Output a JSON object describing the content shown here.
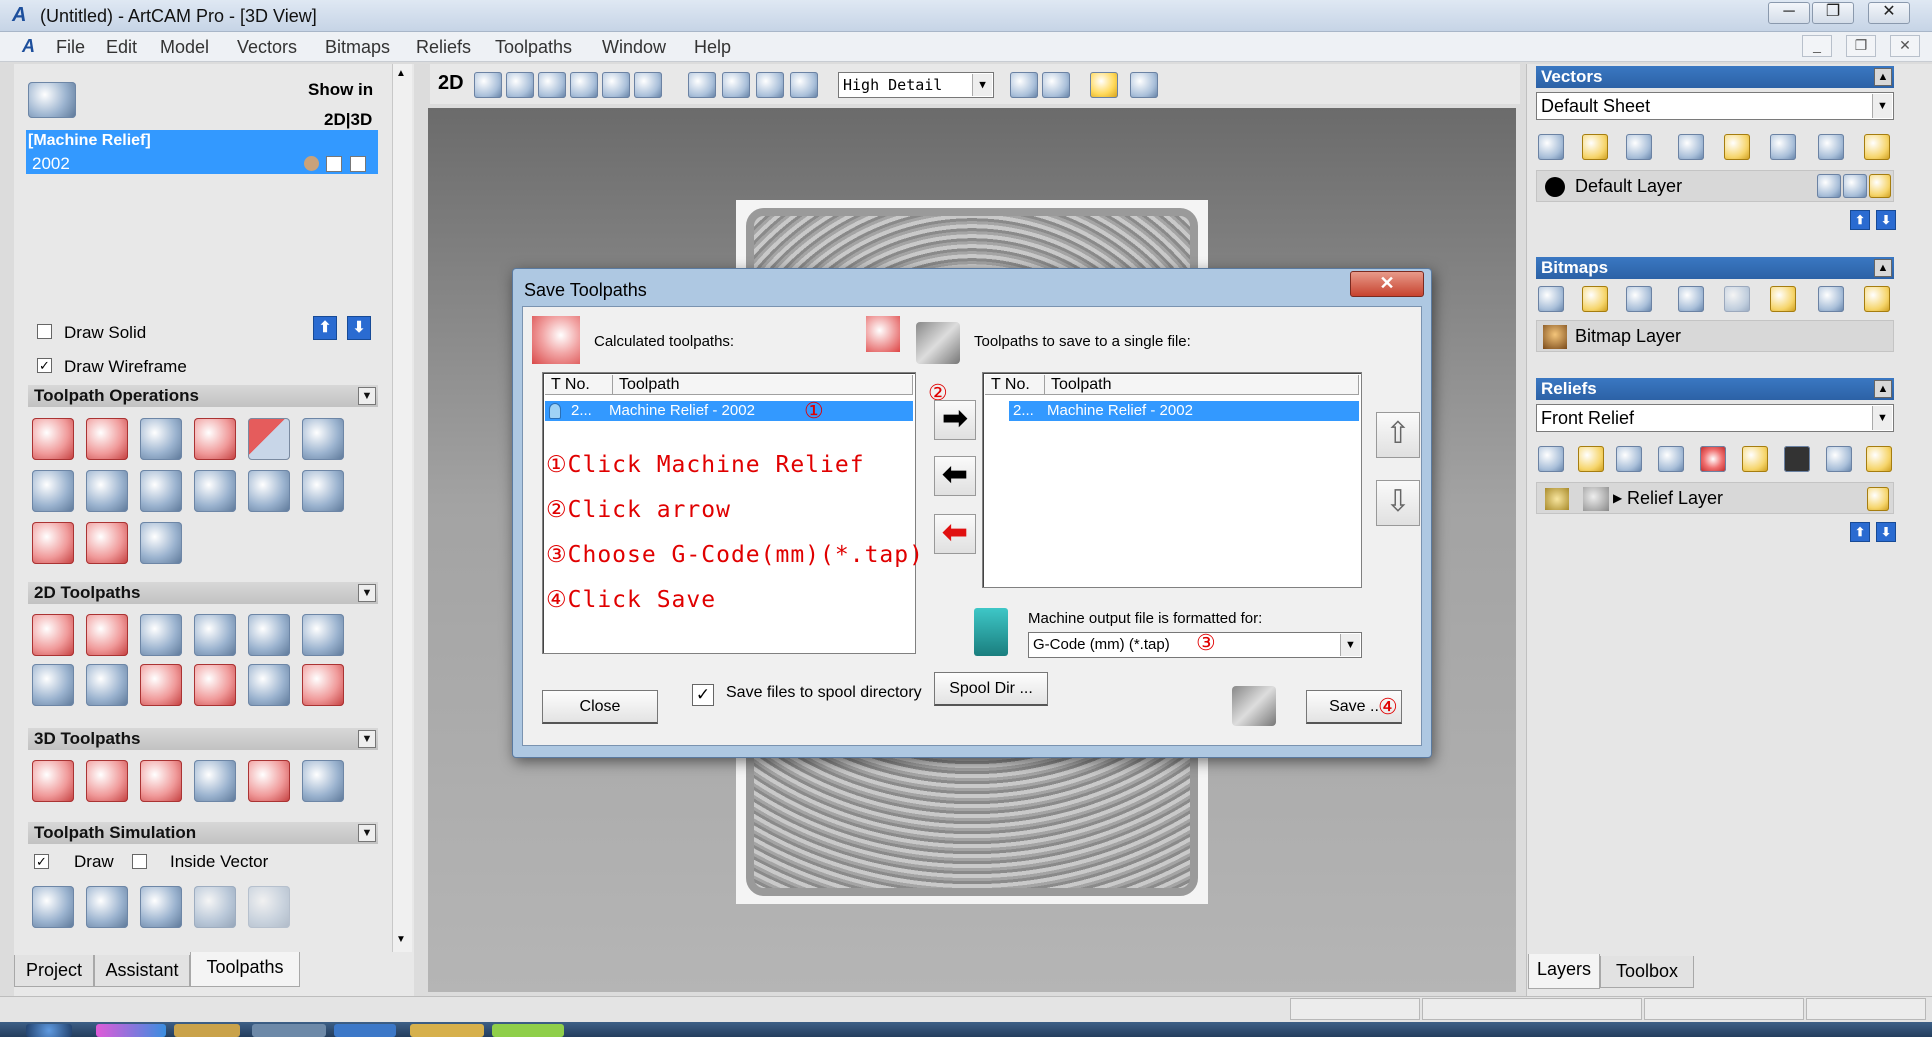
{
  "window": {
    "title": "(Untitled) - ArtCAM Pro - [3D View]",
    "controls": {
      "minimize": "─",
      "restore": "❐",
      "close": "✕"
    }
  },
  "menu": [
    "File",
    "Edit",
    "Model",
    "Vectors",
    "Bitmaps",
    "Reliefs",
    "Toolpaths",
    "Window",
    "Help"
  ],
  "mdi_controls": {
    "minimize": "_",
    "restore": "❐",
    "close": "✕"
  },
  "left_panel": {
    "show_in_label": "Show in",
    "show_in_modes": "2D|3D",
    "selected_item": {
      "line1": "[Machine Relief]",
      "line2": "2002"
    },
    "draw_solid": {
      "label": "Draw Solid",
      "checked": false
    },
    "draw_wireframe": {
      "label": "Draw Wireframe",
      "checked": true
    },
    "sections": {
      "toolpath_operations": "Toolpath Operations",
      "toolpaths_2d": "2D Toolpaths",
      "toolpaths_3d": "3D Toolpaths",
      "simulation": "Toolpath Simulation"
    },
    "simulation_options": {
      "draw": "Draw",
      "inside_vector": "Inside Vector"
    },
    "tabs": [
      "Project",
      "Assistant",
      "Toolpaths"
    ],
    "active_tab": "Toolpaths"
  },
  "view_toolbar": {
    "mode_label": "2D",
    "detail_select": "High Detail"
  },
  "dialog": {
    "title": "Save Toolpaths",
    "close_glyph": "✕",
    "calculated_label": "Calculated toolpaths:",
    "save_label": "Toolpaths to save to a single file:",
    "columns": {
      "tno": "T No.",
      "toolpath": "Toolpath"
    },
    "left_rows": [
      {
        "tno": "2...",
        "name": "Machine Relief - 2002"
      }
    ],
    "right_rows": [
      {
        "tno": "2...",
        "name": "Machine Relief - 2002"
      }
    ],
    "machine_output_label": "Machine output file is formatted for:",
    "machine_output_value": "G-Code (mm) (*.tap)",
    "spool_checkbox_label": "Save files to spool directory",
    "spool_checked": true,
    "spool_dir_button": "Spool Dir ...",
    "close_button": "Close",
    "save_button": "Save ..",
    "annotations": {
      "steps": [
        "①Click Machine Relief",
        "②Click arrow",
        "③Choose G-Code(mm)(*.tap)",
        "④Click Save"
      ],
      "m1": "①",
      "m2": "②",
      "m3": "③",
      "m4": "④"
    }
  },
  "right_panel": {
    "vectors": {
      "title": "Vectors",
      "sheet": "Default Sheet",
      "layer": "Default Layer"
    },
    "bitmaps": {
      "title": "Bitmaps",
      "layer": "Bitmap Layer"
    },
    "reliefs": {
      "title": "Reliefs",
      "relief": "Front Relief",
      "layer": "Relief Layer"
    },
    "tabs": [
      "Layers",
      "Toolbox"
    ]
  }
}
